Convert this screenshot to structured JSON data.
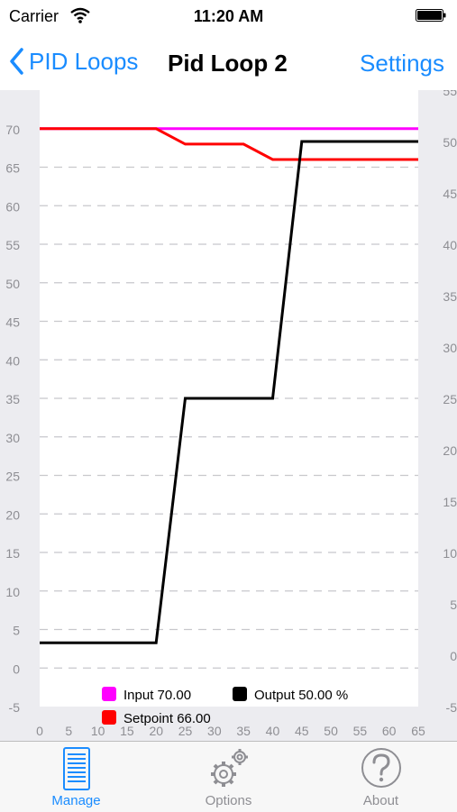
{
  "status": {
    "carrier": "Carrier",
    "time": "11:20 AM"
  },
  "nav": {
    "back_label": "PID Loops",
    "title": "Pid Loop 2",
    "settings_label": "Settings"
  },
  "tabs": [
    {
      "label": "Manage",
      "icon": "server-icon",
      "active": true
    },
    {
      "label": "Options",
      "icon": "gears-icon",
      "active": false
    },
    {
      "label": "About",
      "icon": "question-icon",
      "active": false
    }
  ],
  "colors": {
    "accent": "#1a8cff",
    "tab_inactive": "#8e8e93",
    "input": "#ff00ff",
    "setpoint": "#ff0000",
    "output": "#000000"
  },
  "chart_data": {
    "type": "line",
    "x_ticks": [
      "0",
      "5",
      "10",
      "15",
      "20",
      "25",
      "30",
      "35",
      "40",
      "45",
      "50",
      "55",
      "60",
      "65"
    ],
    "y_left_ticks": [
      "-5",
      "0",
      "5",
      "10",
      "15",
      "20",
      "25",
      "30",
      "35",
      "40",
      "45",
      "50",
      "55",
      "60",
      "65",
      "70"
    ],
    "y_right_ticks": [
      "-5",
      "0",
      "5",
      "10",
      "15",
      "20",
      "25",
      "30",
      "35",
      "40",
      "45",
      "50",
      "55"
    ],
    "xlim": [
      0,
      65
    ],
    "ylim_left": [
      -5,
      75
    ],
    "ylim_right": [
      -5,
      55
    ],
    "grid": true,
    "legend_entries": [
      {
        "label": "Input 70.00",
        "color": "#ff00ff"
      },
      {
        "label": "Output 50.00 %",
        "color": "#000000"
      },
      {
        "label": "Setpoint 66.00",
        "color": "#ff0000"
      }
    ],
    "series": [
      {
        "name": "Input",
        "axis": "left",
        "color": "#ff00ff",
        "x": [
          0,
          65
        ],
        "y": [
          70,
          70
        ]
      },
      {
        "name": "Setpoint",
        "axis": "left",
        "color": "#ff0000",
        "x": [
          0,
          20,
          25,
          35,
          40,
          65
        ],
        "y": [
          70,
          70,
          68,
          68,
          66,
          66
        ]
      },
      {
        "name": "Output",
        "axis": "right",
        "color": "#000000",
        "x": [
          0,
          20,
          25,
          40,
          45,
          65
        ],
        "y": [
          1.2,
          1.2,
          25,
          25,
          50,
          50
        ]
      }
    ]
  }
}
